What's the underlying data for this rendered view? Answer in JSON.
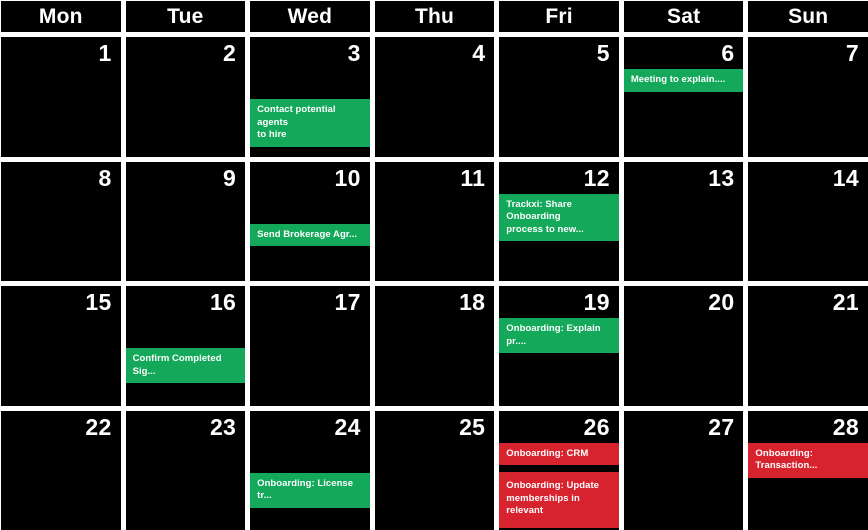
{
  "colors": {
    "cell_background": "#000000",
    "page_background": "#ffffff",
    "text": "#ffffff",
    "event_green": "#13a85a",
    "event_red": "#d6232e"
  },
  "weekday_headers": [
    "Mon",
    "Tue",
    "Wed",
    "Thu",
    "Fri",
    "Sat",
    "Sun"
  ],
  "weeks": [
    {
      "days": [
        {
          "number": "1",
          "events": []
        },
        {
          "number": "2",
          "events": []
        },
        {
          "number": "3",
          "events": [
            {
              "title": "Contact potential agents\nto hire",
              "color": "green",
              "slot": 2,
              "lines": 2
            }
          ]
        },
        {
          "number": "4",
          "events": []
        },
        {
          "number": "5",
          "events": []
        },
        {
          "number": "6",
          "events": [
            {
              "title": "Meeting to explain....",
              "color": "green",
              "slot": 1,
              "lines": 1
            }
          ]
        },
        {
          "number": "7",
          "events": []
        }
      ]
    },
    {
      "days": [
        {
          "number": "8",
          "events": []
        },
        {
          "number": "9",
          "events": []
        },
        {
          "number": "10",
          "events": [
            {
              "title": "Send Brokerage Agr...",
              "color": "green",
              "slot": 2,
              "lines": 1
            }
          ]
        },
        {
          "number": "11",
          "events": []
        },
        {
          "number": "12",
          "events": [
            {
              "title": "Trackxi: Share Onboarding\nprocess to new...",
              "color": "green",
              "slot": 1,
              "lines": 2
            }
          ]
        },
        {
          "number": "13",
          "events": []
        },
        {
          "number": "14",
          "events": []
        }
      ]
    },
    {
      "days": [
        {
          "number": "15",
          "events": []
        },
        {
          "number": "16",
          "events": [
            {
              "title": "Confirm Completed Sig...",
              "color": "green",
              "slot": 2,
              "lines": 1
            }
          ]
        },
        {
          "number": "17",
          "events": []
        },
        {
          "number": "18",
          "events": []
        },
        {
          "number": "19",
          "events": [
            {
              "title": "Onboarding: Explain pr....",
              "color": "green",
              "slot": 1,
              "lines": 1
            }
          ]
        },
        {
          "number": "20",
          "events": []
        },
        {
          "number": "21",
          "events": []
        }
      ]
    },
    {
      "days": [
        {
          "number": "22",
          "events": []
        },
        {
          "number": "23",
          "events": []
        },
        {
          "number": "24",
          "events": [
            {
              "title": "Onboarding: License tr...",
              "color": "green",
              "slot": 2,
              "lines": 1
            }
          ]
        },
        {
          "number": "25",
          "events": []
        },
        {
          "number": "26",
          "events": [
            {
              "title": "Onboarding: CRM",
              "color": "red",
              "slot": 1,
              "lines": 1
            },
            {
              "title": "Onboarding: Update\nmemberships in relevant",
              "color": "red",
              "slot": 0,
              "lines": 2,
              "tall": true
            }
          ]
        },
        {
          "number": "27",
          "events": []
        },
        {
          "number": "28",
          "events": [
            {
              "title": "Onboarding: Transaction...",
              "color": "red",
              "slot": 1,
              "lines": 1
            }
          ]
        }
      ]
    }
  ]
}
